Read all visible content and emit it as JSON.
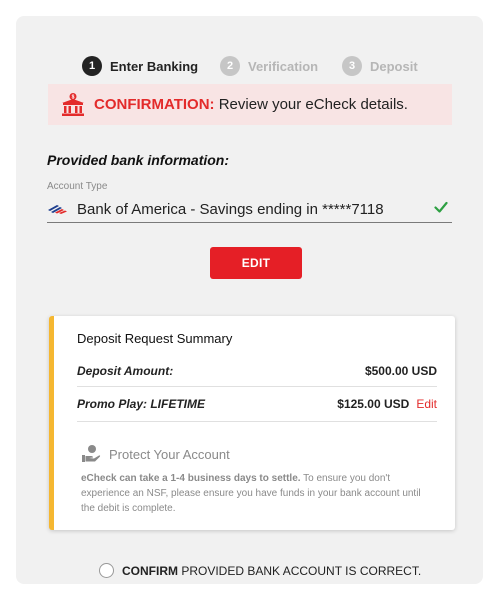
{
  "stepper": {
    "steps": [
      {
        "number": "1",
        "label": "Enter Banking",
        "state": "active"
      },
      {
        "number": "2",
        "label": "Verification",
        "state": "inactive"
      },
      {
        "number": "3",
        "label": "Deposit",
        "state": "inactive"
      }
    ]
  },
  "banner": {
    "icon": "bank-icon",
    "title": "CONFIRMATION:",
    "message": " Review your eCheck details."
  },
  "bank_info": {
    "heading": "Provided bank information:",
    "field_label": "Account Type",
    "account_value": "Bank of America - Savings ending in *****7118",
    "flag_icon": "bank-of-america-flag-icon",
    "valid_icon": "checkmark-icon"
  },
  "edit_button": {
    "label": "EDIT"
  },
  "summary": {
    "title": "Deposit Request Summary",
    "rows": [
      {
        "label": "Deposit Amount:",
        "value": "$500.00 USD",
        "action": ""
      },
      {
        "label": "Promo Play: LIFETIME",
        "value": "$125.00 USD",
        "action": "Edit"
      }
    ],
    "protect_title": "Protect Your Account",
    "note_bold": "eCheck can take a 1-4 business days to settle.",
    "note_rest": " To ensure you don't experience an NSF, please ensure you have funds in your bank account until the debit is complete."
  },
  "confirm": {
    "bold": "CONFIRM",
    "rest": " PROVIDED BANK ACCOUNT IS CORRECT."
  },
  "colors": {
    "accent_red": "#e51f26",
    "card_accent": "#f5b731",
    "banner_bg": "#f8e4e4",
    "check_green": "#2ea043"
  }
}
